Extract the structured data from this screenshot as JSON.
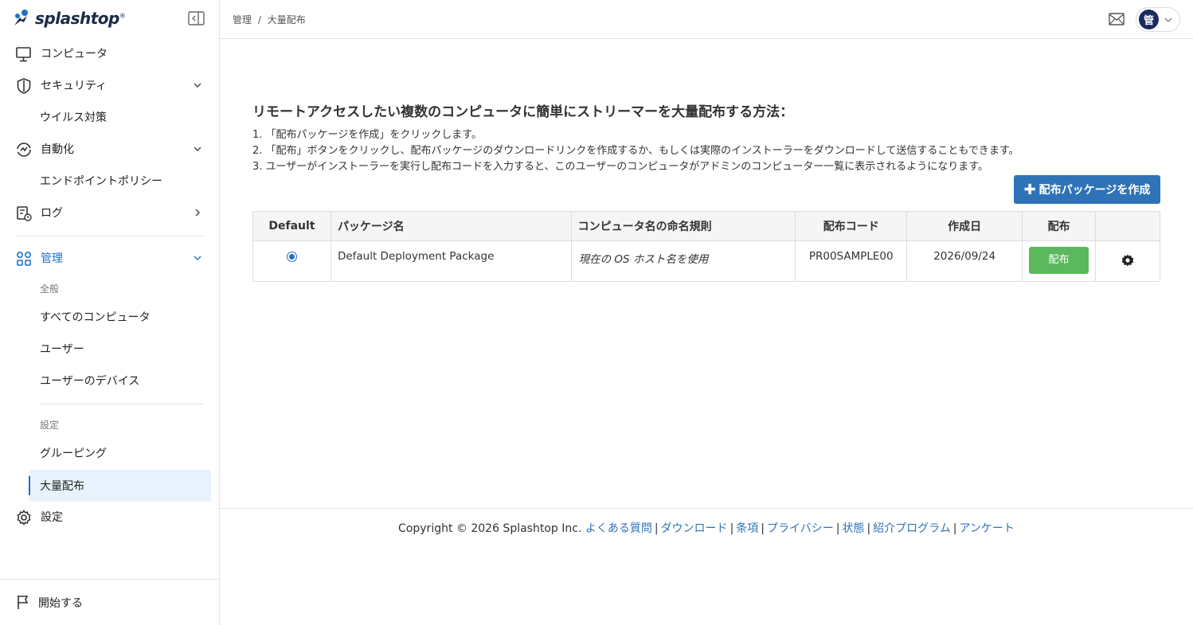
{
  "app": {
    "logo_text": "splashtop",
    "logo_mark": "®"
  },
  "sidebar": {
    "items": [
      {
        "label": "コンピュータ"
      },
      {
        "label": "セキュリティ"
      },
      {
        "label": "ウイルス対策"
      },
      {
        "label": "自動化"
      },
      {
        "label": "エンドポイントポリシー"
      },
      {
        "label": "ログ"
      },
      {
        "label": "管理"
      },
      {
        "label": "すべてのコンピュータ"
      },
      {
        "label": "ユーザー"
      },
      {
        "label": "ユーザーのデバイス"
      },
      {
        "label": "グルーピング"
      },
      {
        "label": "大量配布"
      },
      {
        "label": "設定"
      }
    ],
    "section_general": "全般",
    "section_settings": "設定",
    "start_label": "開始する"
  },
  "header": {
    "breadcrumb": [
      "管理",
      "/",
      "大量配布"
    ],
    "avatar_initial": "管"
  },
  "main": {
    "title": "リモートアクセスしたい複数のコンピュータに簡単にストリーマーを大量配布する方法：",
    "steps": [
      "1. 「配布パッケージを作成」をクリックします。",
      "2. 「配布」ボタンをクリックし、配布パッケージのダウンロードリンクを作成するか、もしくは実際のインストーラーをダウンロードして送信することもできます。",
      "3. ユーザーがインストーラーを実行し配布コードを入力すると、このユーザーのコンピュータがアドミンのコンピューター一覧に表示されるようになります。"
    ],
    "create_button": "配布パッケージを作成"
  },
  "table": {
    "headers": [
      "Default",
      "パッケージ名",
      "コンピュータ名の命名規則",
      "配布コード",
      "作成日",
      "配布"
    ],
    "rows": [
      {
        "default": true,
        "package_name": "Default Deployment Package",
        "naming_rule": "現在の OS ホスト名を使用",
        "code": "PR00SAMPLE00",
        "created": "2026/09/24",
        "dist_button": "配布"
      }
    ]
  },
  "footer": {
    "copyright": "Copyright © 2026 Splashtop Inc.",
    "links": [
      "よくある質問",
      "ダウンロード",
      "条項",
      "プライバシー",
      "状態",
      "紹介プログラム",
      "アンケート"
    ]
  },
  "colors": {
    "accent": "#1f6fc7",
    "primary_button": "#2e73b8",
    "success_button": "#5cb85c"
  },
  "icons": [
    "monitor-icon",
    "shield-icon",
    "automation-icon",
    "log-icon",
    "admin-grid-icon",
    "gear-icon",
    "flag-icon",
    "mail-icon",
    "collapse-sidebar-icon",
    "chevron-down-icon",
    "chevron-right-icon",
    "settings-gear-icon"
  ]
}
